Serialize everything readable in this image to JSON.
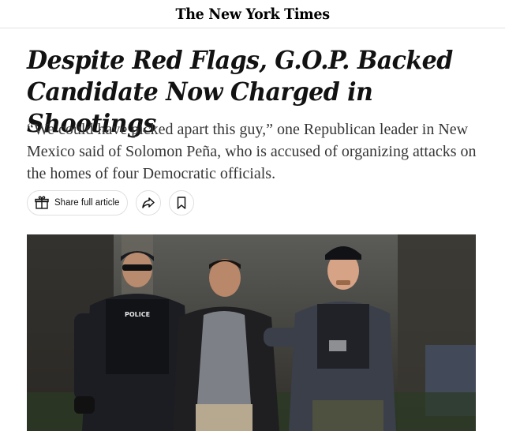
{
  "masthead": {
    "logo": "The New York Times"
  },
  "article": {
    "headline": "Despite Red Flags, G.O.P. Backed Candidate Now Charged in Shootings",
    "summary": "“We could have picked apart this guy,” one Republican leader in New Mexico said of Solomon Peña, who is accused of organizing attacks on the homes of four Democratic officials."
  },
  "actions": {
    "share_label": "Share full article",
    "share_icon": "gift-icon",
    "forward_icon": "share-arrow-icon",
    "save_icon": "bookmark-icon"
  },
  "photo": {
    "vest_text": "POLICE",
    "colors": {
      "sky": "#5b5c58",
      "vest": "#1b1d22",
      "shirt": "#7d8086"
    }
  }
}
